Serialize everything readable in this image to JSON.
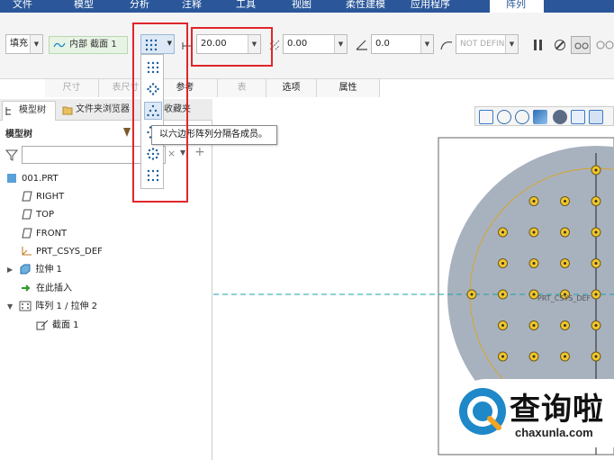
{
  "ribbon": {
    "tabs": [
      "文件",
      "模型",
      "分析",
      "注释",
      "工具",
      "视图",
      "柔性建模",
      "应用程序",
      "阵列"
    ]
  },
  "toolbar": {
    "fill_label": "填充",
    "sketch_label": "内部 截面 1",
    "spacing_value": "20.00",
    "offset_value": "0.00",
    "angle_value": "0.0",
    "not_defined_label": "NOT DEFIN"
  },
  "sub_tabs": [
    "尺寸",
    "表尺寸",
    "参考",
    "表",
    "选项",
    "属性"
  ],
  "pattern_menu": {
    "tooltip": "以六边形阵列分隔各成员。"
  },
  "left_panel": {
    "tabs": [
      "模型树",
      "文件夹浏览器",
      "收藏夹"
    ],
    "header": "模型树",
    "filter_placeholder": "",
    "tree": [
      {
        "label": "001.PRT"
      },
      {
        "label": "RIGHT"
      },
      {
        "label": "TOP"
      },
      {
        "label": "FRONT"
      },
      {
        "label": "PRT_CSYS_DEF"
      },
      {
        "label": "拉伸 1"
      },
      {
        "label": "在此插入"
      },
      {
        "label": "阵列 1 / 拉伸 2"
      },
      {
        "label": "截面 1"
      }
    ]
  },
  "graphics": {
    "csys_label": "PRT_CSYS_DEF"
  },
  "watermark": {
    "cn": "查询啦",
    "url": "chaxunla.com"
  },
  "colors": {
    "ribbon_blue": "#2b579a",
    "highlight_red": "#e0262b",
    "disk_gray": "#a8b2bf",
    "hole_yellow": "#f2c62a",
    "accent_blue": "#1e88c9"
  }
}
